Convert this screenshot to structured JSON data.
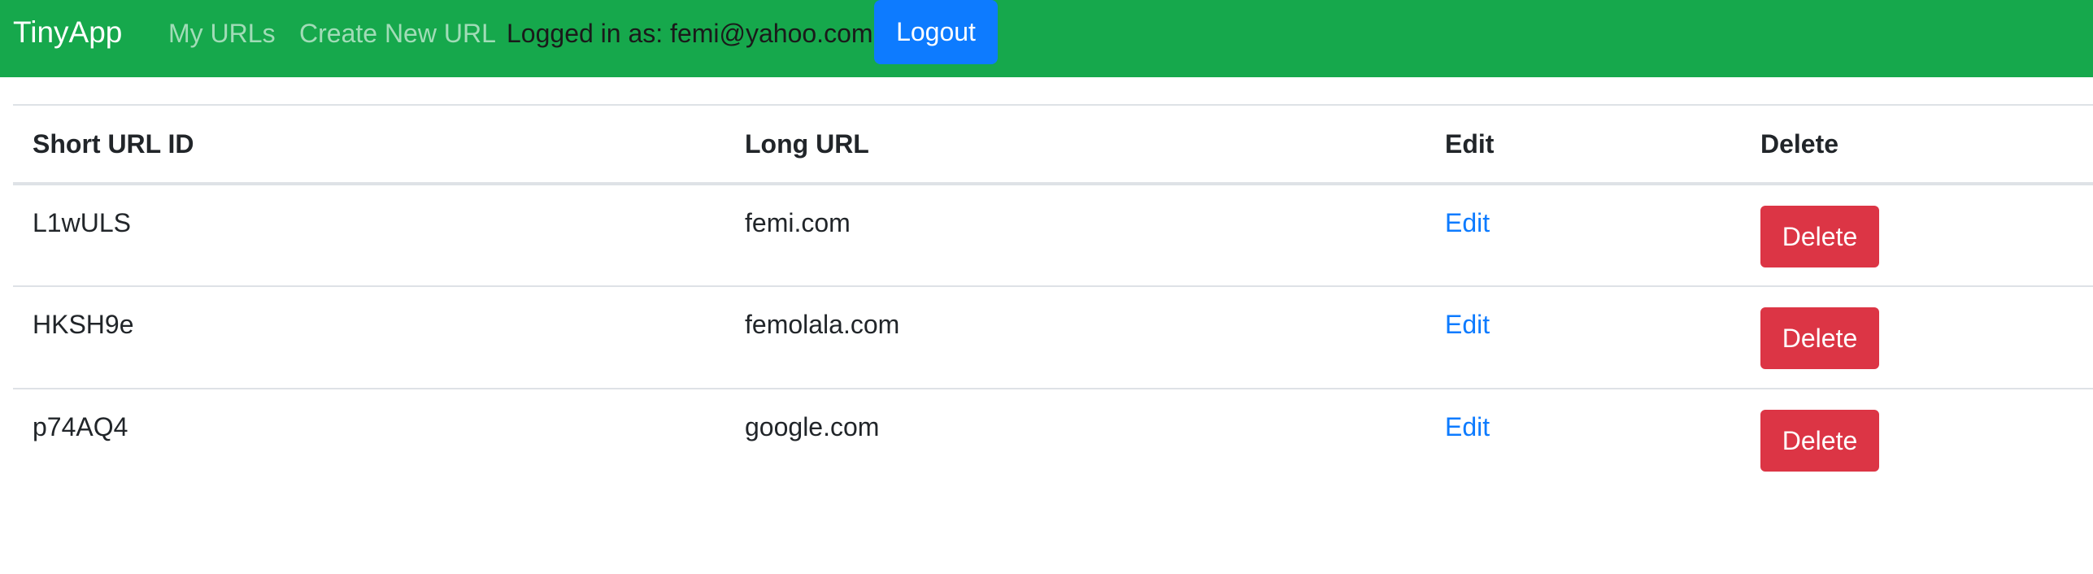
{
  "nav": {
    "brand": "TinyApp",
    "my_urls": "My URLs",
    "create_new_url": "Create New URL",
    "logged_in_text": "Logged in as: femi@yahoo.com",
    "logout_label": "Logout"
  },
  "table": {
    "headers": {
      "short_url_id": "Short URL ID",
      "long_url": "Long URL",
      "edit": "Edit",
      "delete": "Delete"
    },
    "rows": [
      {
        "short_id": "L1wULS",
        "long_url": "femi.com",
        "edit_label": "Edit",
        "delete_label": "Delete"
      },
      {
        "short_id": "HKSH9e",
        "long_url": "femolala.com",
        "edit_label": "Edit",
        "delete_label": "Delete"
      },
      {
        "short_id": "p74AQ4",
        "long_url": "google.com",
        "edit_label": "Edit",
        "delete_label": "Delete"
      }
    ]
  },
  "colors": {
    "navbar_bg": "#16a84c",
    "logout_bg": "#0d7bff",
    "delete_bg": "#dc3545",
    "link": "#0d7bff"
  }
}
